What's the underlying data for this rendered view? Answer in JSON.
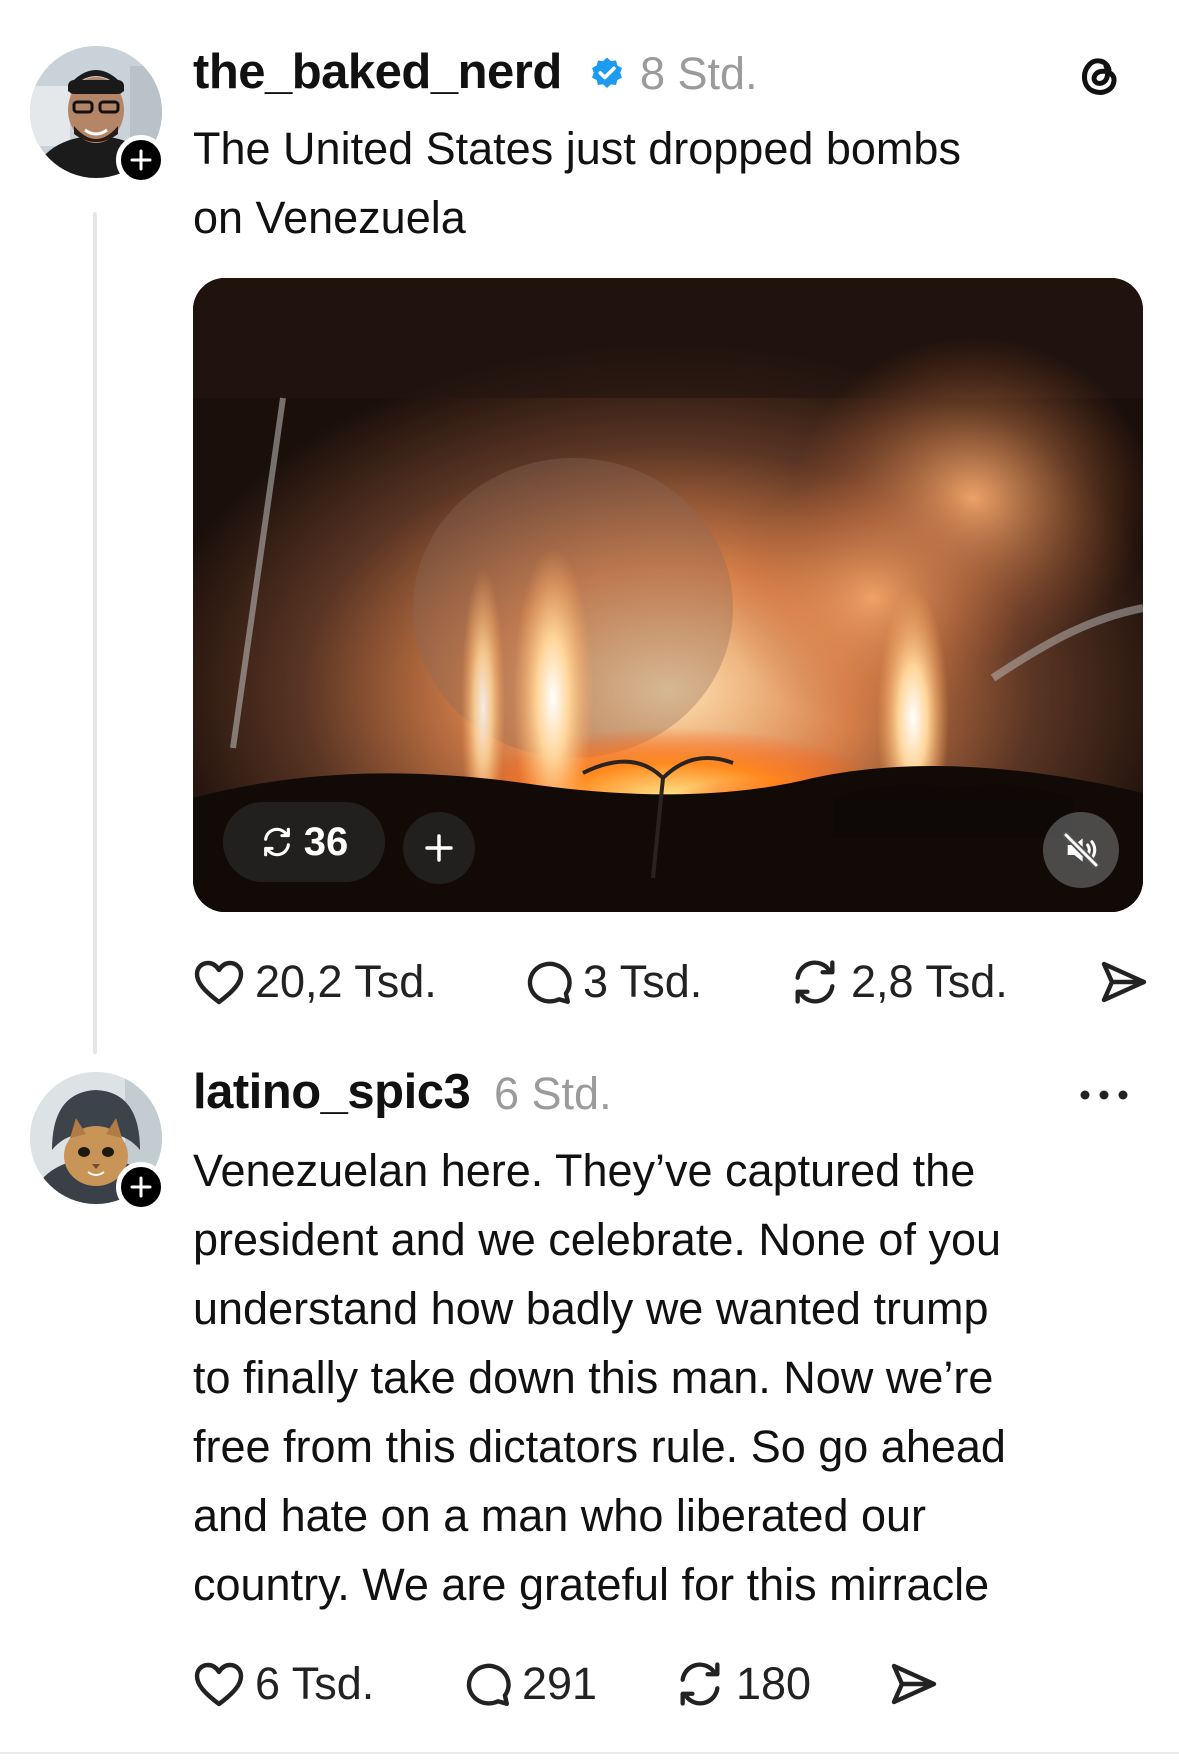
{
  "post": {
    "username": "the_baked_nerd",
    "verified": true,
    "time": "8 Std.",
    "text_lines": [
      "The United States just dropped bombs",
      "on Venezuela"
    ],
    "media": {
      "repost_count": "36",
      "muted": true
    },
    "actions": {
      "likes": "20,2 Tsd.",
      "replies": "3 Tsd.",
      "reposts": "2,8 Tsd."
    },
    "brand_icon": "threads-icon"
  },
  "reply": {
    "username": "latino_spic3",
    "time": "6 Std.",
    "text_lines": [
      "Venezuelan here. They’ve captured the",
      "president and we celebrate. None of you",
      "understand how badly we wanted trump",
      "to finally take down this man. Now we’re",
      "free from this dictators rule. So go ahead",
      "and hate on a man who liberated our",
      "country. We are grateful for this mirracle"
    ],
    "actions": {
      "likes": "6 Tsd.",
      "replies": "291",
      "reposts": "180"
    }
  },
  "colors": {
    "verified": "#1d9bf0",
    "muted_text": "#9b9b9b",
    "text": "#111111"
  }
}
